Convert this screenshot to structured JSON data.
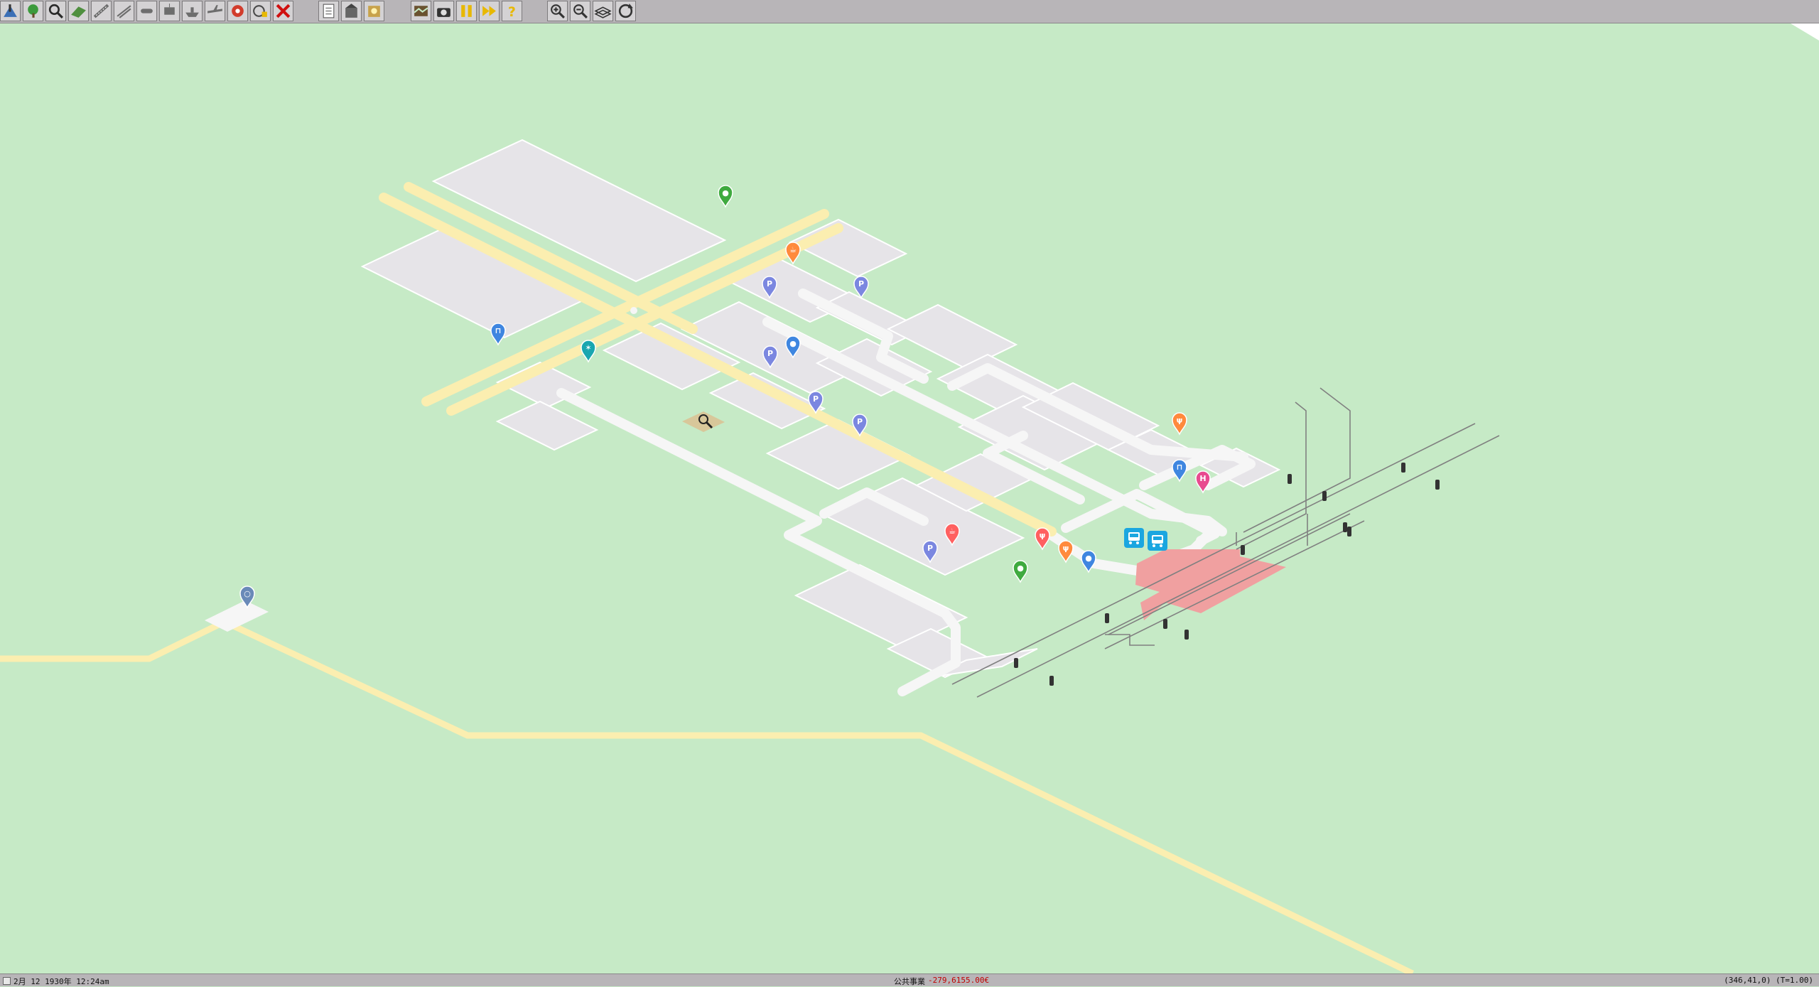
{
  "toolbar": {
    "groups": [
      {
        "name": "main-tools",
        "buttons": [
          {
            "icon": "terraform-icon",
            "color": "#3b6fb6"
          },
          {
            "icon": "plant-trees-icon",
            "color": "#3c9a3c"
          },
          {
            "icon": "query-icon",
            "color": "#2a2a2a"
          },
          {
            "icon": "slope-icon",
            "color": "#4f8f3f"
          },
          {
            "icon": "road-tools-icon",
            "color": "#6d6d6d"
          },
          {
            "icon": "rail-tools-icon",
            "color": "#6d6d6d"
          },
          {
            "icon": "monorail-tools-icon",
            "color": "#6d6d6d"
          },
          {
            "icon": "tram-tools-icon",
            "color": "#6d6d6d"
          },
          {
            "icon": "ship-tools-icon",
            "color": "#6d6d6d"
          },
          {
            "icon": "air-tools-icon",
            "color": "#6d6d6d"
          },
          {
            "icon": "special-tools-icon",
            "color": "#d23c2c"
          },
          {
            "icon": "listtool-icon",
            "color": "#4a4a4a"
          },
          {
            "icon": "remove-icon",
            "color": "#d01010"
          }
        ]
      },
      {
        "name": "info-tools",
        "buttons": [
          {
            "icon": "list-icon",
            "color": "#555555"
          },
          {
            "icon": "company-icon",
            "color": "#666666"
          },
          {
            "icon": "finance-icon",
            "color": "#c8a24a"
          }
        ]
      },
      {
        "name": "game-controls",
        "buttons": [
          {
            "icon": "map-icon",
            "color": "#6a5230"
          },
          {
            "icon": "screenshot-icon",
            "color": "#333333"
          },
          {
            "icon": "pause-icon",
            "color": "#e8b800"
          },
          {
            "icon": "fast-forward-icon",
            "color": "#e8b800"
          },
          {
            "icon": "help-icon",
            "color": "#e8b800"
          }
        ]
      },
      {
        "name": "view-controls",
        "buttons": [
          {
            "icon": "zoom-in-icon",
            "color": "#333333"
          },
          {
            "icon": "zoom-out-icon",
            "color": "#333333"
          },
          {
            "icon": "view-layers-icon",
            "color": "#333333"
          },
          {
            "icon": "rotate-icon",
            "color": "#333333"
          }
        ]
      }
    ]
  },
  "map": {
    "colors": {
      "grass": "#c6eac6",
      "block": "#e6e4e8",
      "block_edge": "#ffffff",
      "street": "#f6f6f6",
      "highway": "#fbeeb0",
      "highway_edge": "#f3e09a",
      "station": "#f0a0a0",
      "rail": "#808080",
      "plaza": "#d8c79a"
    },
    "markers": [
      {
        "icon": "park-pin-icon",
        "color": "#3faa3f"
      },
      {
        "icon": "cafe-pin-icon",
        "color": "#ff8a3d"
      },
      {
        "icon": "parking-pin-icon",
        "color": "#7b87e0"
      },
      {
        "icon": "parking-pin-icon",
        "color": "#7b87e0"
      },
      {
        "icon": "shop-pin-icon",
        "color": "#3f86e0"
      },
      {
        "icon": "attraction-pin-icon",
        "color": "#1aa6b0"
      },
      {
        "icon": "parking-pin-icon",
        "color": "#7b87e0"
      },
      {
        "icon": "locked-pin-icon",
        "color": "#3f86e0"
      },
      {
        "icon": "parking-pin-icon",
        "color": "#7b87e0"
      },
      {
        "icon": "parking-pin-icon",
        "color": "#7b87e0"
      },
      {
        "icon": "restaurant-pin-icon",
        "color": "#ff8a3d"
      },
      {
        "icon": "shop-pin-icon",
        "color": "#3f86e0"
      },
      {
        "icon": "hotel-pin-icon",
        "color": "#e84a8f"
      },
      {
        "icon": "bus-stop-icon",
        "color": "#1aa6e0"
      },
      {
        "icon": "bus-stop-icon",
        "color": "#1aa6e0"
      },
      {
        "icon": "restaurant-pin-icon",
        "color": "#ff6060"
      },
      {
        "icon": "cafe-pin-icon",
        "color": "#ff6060"
      },
      {
        "icon": "restaurant-pin-icon",
        "color": "#ff8a3d"
      },
      {
        "icon": "locked-pin-icon",
        "color": "#3f86e0"
      },
      {
        "icon": "parking-pin-icon",
        "color": "#7b87e0"
      },
      {
        "icon": "park-pin-icon",
        "color": "#3faa3f"
      },
      {
        "icon": "landmark-pin-icon",
        "color": "#6a8ab8"
      }
    ]
  },
  "status": {
    "date": "2月 12 1930年 12:24am",
    "account_label": "公共事業",
    "money": "-279,6155.00€",
    "coordinates": "(346,41,0) (T=1.00)"
  }
}
